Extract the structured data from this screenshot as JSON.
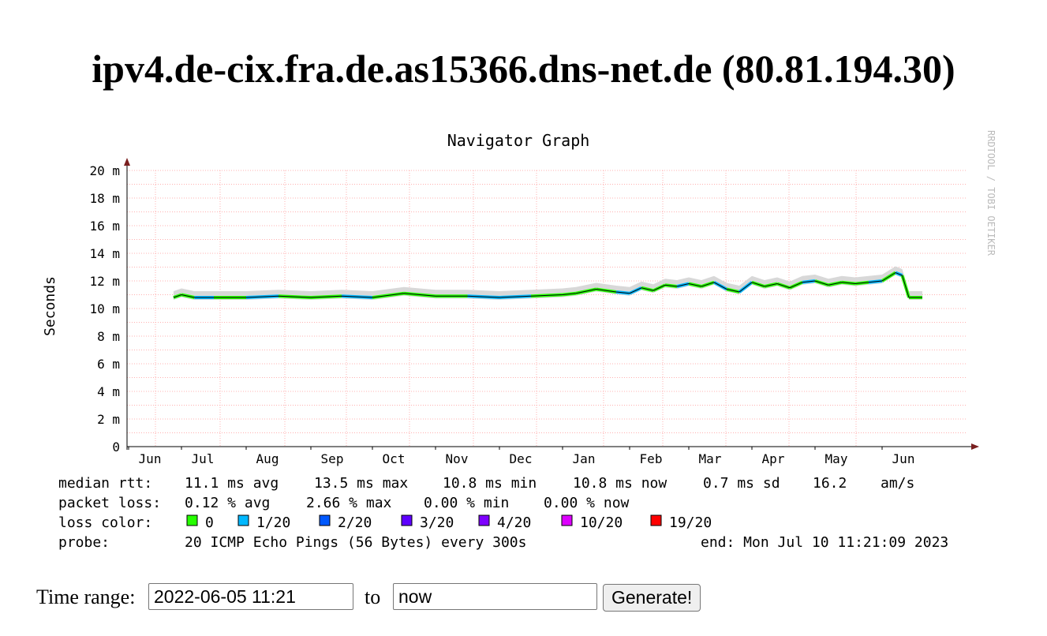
{
  "page": {
    "title": "ipv4.de-cix.fra.de.as15366.dns-net.de (80.81.194.30)"
  },
  "chart_data": {
    "type": "line",
    "title": "Navigator Graph",
    "ylabel": "Seconds",
    "watermark": "RRDTOOL / TOBI OETIKER",
    "y_ticks": [
      "0",
      "2 m",
      "4 m",
      "6 m",
      "8 m",
      "10 m",
      "12 m",
      "14 m",
      "16 m",
      "18 m",
      "20 m"
    ],
    "ylim_ms": [
      0,
      20
    ],
    "x_ticks": [
      "Jun",
      "Jul",
      "Aug",
      "Sep",
      "Oct",
      "Nov",
      "Dec",
      "Jan",
      "Feb",
      "Mar",
      "Apr",
      "May",
      "Jun"
    ],
    "grid": true,
    "series": [
      {
        "name": "median rtt",
        "unit": "ms",
        "x_months": [
          0.85,
          1.0,
          1.2,
          1.5,
          2.0,
          2.5,
          3.0,
          3.5,
          4.0,
          4.5,
          5.0,
          5.5,
          6.0,
          6.5,
          7.0,
          7.2,
          7.5,
          7.8,
          8.0,
          8.2,
          8.4,
          8.6,
          8.8,
          9.0,
          9.2,
          9.4,
          9.6,
          9.8,
          10.0,
          10.2,
          10.4,
          10.6,
          10.8,
          11.0,
          11.2,
          11.4,
          11.6,
          11.8,
          12.0,
          12.2,
          12.3,
          12.4,
          12.6
        ],
        "values": [
          10.8,
          11.0,
          10.8,
          10.8,
          10.8,
          10.9,
          10.8,
          10.9,
          10.8,
          11.1,
          10.9,
          10.9,
          10.8,
          10.9,
          11.0,
          11.1,
          11.4,
          11.2,
          11.1,
          11.5,
          11.3,
          11.7,
          11.6,
          11.8,
          11.6,
          11.9,
          11.4,
          11.2,
          11.9,
          11.6,
          11.8,
          11.5,
          11.9,
          12.0,
          11.7,
          11.9,
          11.8,
          11.9,
          12.0,
          12.6,
          12.4,
          10.8,
          10.8
        ]
      }
    ]
  },
  "stats": {
    "rtt_label": "median rtt:",
    "rtt_avg": "11.1 ms avg",
    "rtt_max": "13.5 ms max",
    "rtt_min": "10.8 ms min",
    "rtt_now": "10.8 ms now",
    "rtt_sd": "0.7 ms sd",
    "rtt_ams": "16.2",
    "rtt_ams_unit": "am/s",
    "loss_label": "packet loss:",
    "loss_avg": "0.12 % avg",
    "loss_max": "2.66 % max",
    "loss_min": "0.00 % min",
    "loss_now": "0.00 % now",
    "color_label": "loss color:",
    "loss_colors": [
      {
        "label": "0",
        "color": "#26ff00"
      },
      {
        "label": "1/20",
        "color": "#00b8ff"
      },
      {
        "label": "2/20",
        "color": "#0059ff"
      },
      {
        "label": "3/20",
        "color": "#5e00ff"
      },
      {
        "label": "4/20",
        "color": "#7e00ff"
      },
      {
        "label": "10/20",
        "color": "#dd00ff"
      },
      {
        "label": "19/20",
        "color": "#ff0000"
      }
    ],
    "probe_label": "probe:",
    "probe_text": "20 ICMP Echo Pings (56 Bytes) every 300s",
    "end_text": "end: Mon Jul 10 11:21:09 2023"
  },
  "form": {
    "label": "Time range:",
    "start_value": "2022-06-05 11:21",
    "to_label": "to",
    "end_value": "now",
    "button_label": "Generate!"
  }
}
